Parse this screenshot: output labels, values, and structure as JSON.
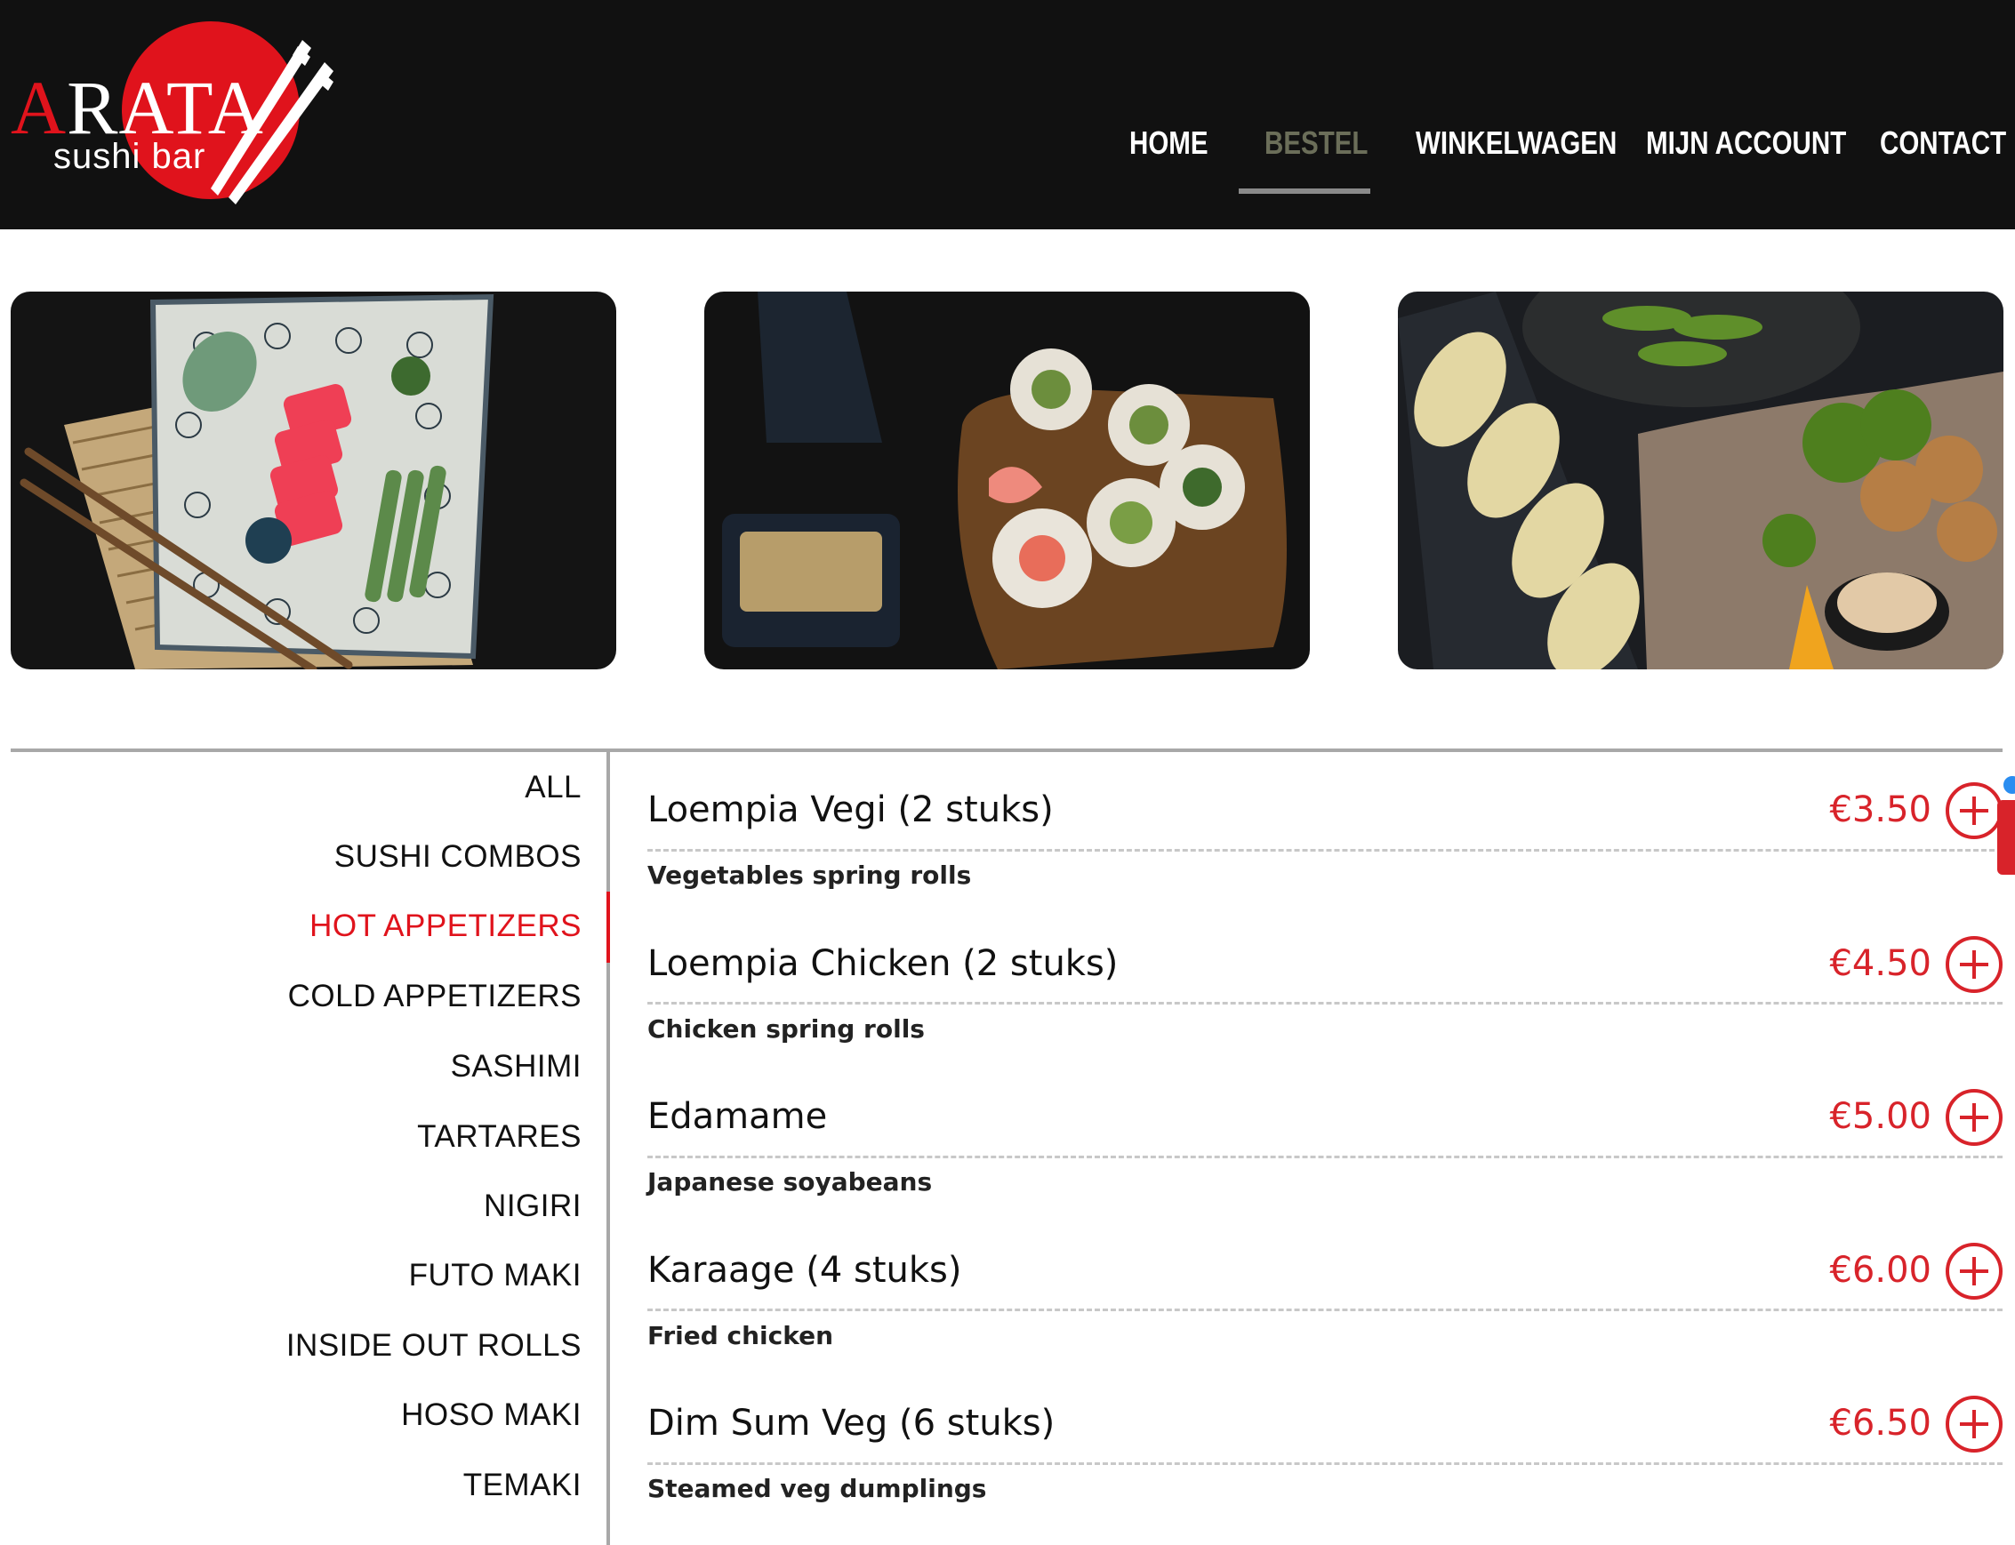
{
  "brand": {
    "logo_first_letter": "A",
    "logo_rest": "RATA",
    "logo_subtitle": "sushi bar",
    "accent_color": "#e0131c"
  },
  "nav": {
    "items": [
      {
        "label": "HOME",
        "active": false
      },
      {
        "label": "BESTEL",
        "active": true
      },
      {
        "label": "WINKELWAGEN",
        "active": false
      },
      {
        "label": "MIJN ACCOUNT",
        "active": false
      },
      {
        "label": "CONTACT",
        "active": false
      }
    ]
  },
  "gallery": {
    "photos": [
      {
        "subject": "tuna sashimi on patterned plate with chopsticks"
      },
      {
        "subject": "sushi rolls on wooden board with soy sauce"
      },
      {
        "subject": "gyoza, edamame and karaage"
      }
    ]
  },
  "categories": [
    {
      "label": "ALL",
      "active": false
    },
    {
      "label": "SUSHI COMBOS",
      "active": false
    },
    {
      "label": "HOT APPETIZERS",
      "active": true
    },
    {
      "label": "COLD APPETIZERS",
      "active": false
    },
    {
      "label": "SASHIMI",
      "active": false
    },
    {
      "label": "TARTARES",
      "active": false
    },
    {
      "label": "NIGIRI",
      "active": false
    },
    {
      "label": "FUTO MAKI",
      "active": false
    },
    {
      "label": "INSIDE OUT ROLLS",
      "active": false
    },
    {
      "label": "HOSO MAKI",
      "active": false
    },
    {
      "label": "TEMAKI",
      "active": false
    }
  ],
  "menu_items": [
    {
      "name": "Loempia Vegi (2 stuks)",
      "price": "€3.50",
      "description": "Vegetables spring rolls"
    },
    {
      "name": "Loempia Chicken (2 stuks)",
      "price": "€4.50",
      "description": "Chicken spring rolls"
    },
    {
      "name": "Edamame",
      "price": "€5.00",
      "description": "Japanese soyabeans"
    },
    {
      "name": "Karaage (4 stuks)",
      "price": "€6.00",
      "description": "Fried chicken"
    },
    {
      "name": "Dim Sum Veg (6 stuks)",
      "price": "€6.50",
      "description": "Steamed veg dumplings"
    }
  ]
}
